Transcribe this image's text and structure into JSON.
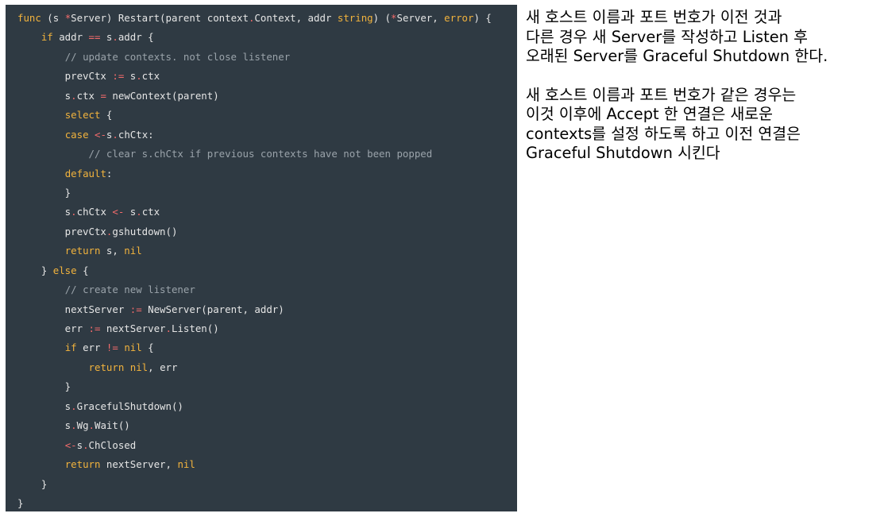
{
  "code": {
    "lines": [
      [
        {
          "t": "func",
          "c": "kw"
        },
        {
          "t": " (s "
        },
        {
          "t": "*",
          "c": "op"
        },
        {
          "t": "Server) Restart(parent context"
        },
        {
          "t": ".",
          "c": "op"
        },
        {
          "t": "Context, addr "
        },
        {
          "t": "string",
          "c": "kw"
        },
        {
          "t": ") ("
        },
        {
          "t": "*",
          "c": "op"
        },
        {
          "t": "Server, "
        },
        {
          "t": "error",
          "c": "kw"
        },
        {
          "t": ") {"
        }
      ],
      [
        {
          "t": "    "
        },
        {
          "t": "if",
          "c": "kw"
        },
        {
          "t": " addr "
        },
        {
          "t": "==",
          "c": "op"
        },
        {
          "t": " s"
        },
        {
          "t": ".",
          "c": "op"
        },
        {
          "t": "addr {"
        }
      ],
      [
        {
          "t": "        "
        },
        {
          "t": "// update contexts. not close listener",
          "c": "cm"
        }
      ],
      [
        {
          "t": "        prevCtx "
        },
        {
          "t": ":=",
          "c": "op"
        },
        {
          "t": " s"
        },
        {
          "t": ".",
          "c": "op"
        },
        {
          "t": "ctx"
        }
      ],
      [
        {
          "t": "        s"
        },
        {
          "t": ".",
          "c": "op"
        },
        {
          "t": "ctx "
        },
        {
          "t": "=",
          "c": "op"
        },
        {
          "t": " newContext(parent)"
        }
      ],
      [
        {
          "t": "        "
        },
        {
          "t": "select",
          "c": "kw"
        },
        {
          "t": " {"
        }
      ],
      [
        {
          "t": "        "
        },
        {
          "t": "case",
          "c": "kw"
        },
        {
          "t": " "
        },
        {
          "t": "<-",
          "c": "op"
        },
        {
          "t": "s"
        },
        {
          "t": ".",
          "c": "op"
        },
        {
          "t": "chCtx:"
        }
      ],
      [
        {
          "t": "            "
        },
        {
          "t": "// clear s.chCtx if previous contexts have not been popped",
          "c": "cm"
        }
      ],
      [
        {
          "t": "        "
        },
        {
          "t": "default",
          "c": "kw"
        },
        {
          "t": ":"
        }
      ],
      [
        {
          "t": "        }"
        }
      ],
      [
        {
          "t": "        s"
        },
        {
          "t": ".",
          "c": "op"
        },
        {
          "t": "chCtx "
        },
        {
          "t": "<-",
          "c": "op"
        },
        {
          "t": " s"
        },
        {
          "t": ".",
          "c": "op"
        },
        {
          "t": "ctx"
        }
      ],
      [
        {
          "t": "        prevCtx"
        },
        {
          "t": ".",
          "c": "op"
        },
        {
          "t": "gshutdown()"
        }
      ],
      [
        {
          "t": "        "
        },
        {
          "t": "return",
          "c": "kw"
        },
        {
          "t": " s, "
        },
        {
          "t": "nil",
          "c": "kw"
        }
      ],
      [
        {
          "t": "    } "
        },
        {
          "t": "else",
          "c": "kw"
        },
        {
          "t": " {"
        }
      ],
      [
        {
          "t": "        "
        },
        {
          "t": "// create new listener",
          "c": "cm"
        }
      ],
      [
        {
          "t": "        nextServer "
        },
        {
          "t": ":=",
          "c": "op"
        },
        {
          "t": " NewServer(parent, addr)"
        }
      ],
      [
        {
          "t": "        err "
        },
        {
          "t": ":=",
          "c": "op"
        },
        {
          "t": " nextServer"
        },
        {
          "t": ".",
          "c": "op"
        },
        {
          "t": "Listen()"
        }
      ],
      [
        {
          "t": "        "
        },
        {
          "t": "if",
          "c": "kw"
        },
        {
          "t": " err "
        },
        {
          "t": "!=",
          "c": "op"
        },
        {
          "t": " "
        },
        {
          "t": "nil",
          "c": "kw"
        },
        {
          "t": " {"
        }
      ],
      [
        {
          "t": "            "
        },
        {
          "t": "return",
          "c": "kw"
        },
        {
          "t": " "
        },
        {
          "t": "nil",
          "c": "kw"
        },
        {
          "t": ", err"
        }
      ],
      [
        {
          "t": "        }"
        }
      ],
      [
        {
          "t": "        s"
        },
        {
          "t": ".",
          "c": "op"
        },
        {
          "t": "GracefulShutdown()"
        }
      ],
      [
        {
          "t": "        s"
        },
        {
          "t": ".",
          "c": "op"
        },
        {
          "t": "Wg"
        },
        {
          "t": ".",
          "c": "op"
        },
        {
          "t": "Wait()"
        }
      ],
      [
        {
          "t": "        "
        },
        {
          "t": "<-",
          "c": "op"
        },
        {
          "t": "s"
        },
        {
          "t": ".",
          "c": "op"
        },
        {
          "t": "ChClosed"
        }
      ],
      [
        {
          "t": "        "
        },
        {
          "t": "return",
          "c": "kw"
        },
        {
          "t": " nextServer, "
        },
        {
          "t": "nil",
          "c": "kw"
        }
      ],
      [
        {
          "t": "    }"
        }
      ],
      [
        {
          "t": "}"
        }
      ]
    ]
  },
  "description": {
    "paragraph1": [
      "새 호스트 이름과 포트 번호가 이전 것과",
      "다른 경우 새 Server를 작성하고 Listen 후",
      "오래된 Server를 Graceful Shutdown 한다."
    ],
    "paragraph2": [
      "새 호스트 이름과 포트 번호가 같은 경우는",
      "이것 이후에 Accept 한 연결은 새로운",
      "contexts를 설정 하도록 하고 이전 연결은",
      "Graceful Shutdown 시킨다"
    ]
  },
  "colors": {
    "code_background": "#2f3a43",
    "keyword": "#f2b33d",
    "operator": "#f26b6b",
    "comment": "#9aa3aa",
    "plain": "#e6e6e6"
  }
}
